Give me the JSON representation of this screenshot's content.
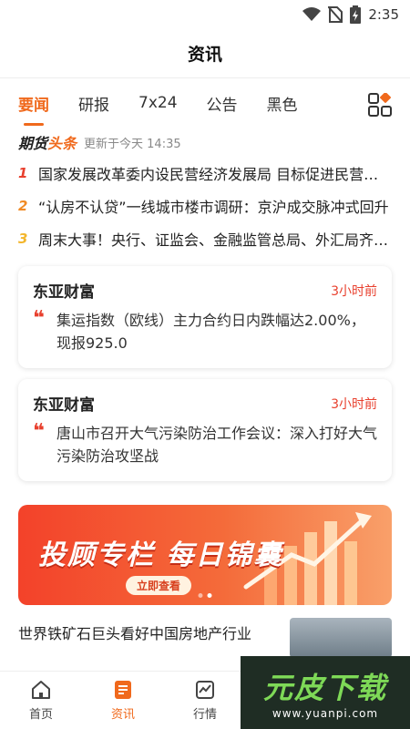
{
  "status_bar": {
    "time": "2:35"
  },
  "header": {
    "title": "资讯"
  },
  "tabs": [
    {
      "label": "要闻",
      "active": true
    },
    {
      "label": "研报"
    },
    {
      "label": "7x24"
    },
    {
      "label": "公告"
    },
    {
      "label": "黑色"
    }
  ],
  "headlines": {
    "brand_prefix": "期货",
    "brand_suffix": "头条",
    "updated": "更新于今天 14:35",
    "items": [
      {
        "rank": "1",
        "text": "国家发展改革委内设民营经济发展局 目标促进民营经济发展壮大"
      },
      {
        "rank": "2",
        "text": "“认房不认贷”一线城市楼市调研：京沪成交脉冲式回升"
      },
      {
        "rank": "3",
        "text": "周末大事！央行、证监会、金融监管总局、外汇局齐发声"
      }
    ]
  },
  "news_cards": [
    {
      "source": "东亚财富",
      "time": "3小时前",
      "text": "集运指数（欧线）主力合约日内跌幅达2.00%，现报925.0"
    },
    {
      "source": "东亚财富",
      "time": "3小时前",
      "text": "唐山市召开大气污染防治工作会议：深入打好大气污染防治攻坚战"
    }
  ],
  "banner": {
    "title": "投顾专栏 每日锦囊",
    "button": "立即查看",
    "slide_count": 2,
    "active_slide": 1
  },
  "article": {
    "title": "世界铁矿石巨头看好中国房地产行业"
  },
  "bottom_nav": [
    {
      "label": "首页",
      "icon": "home-icon"
    },
    {
      "label": "资讯",
      "icon": "news-icon",
      "active": true
    },
    {
      "label": "行情",
      "icon": "chart-icon"
    }
  ],
  "watermark": {
    "logo": "元皮下载",
    "url": "www.yuanpi.com"
  },
  "colors": {
    "accent": "#f0691c",
    "red": "#e8402e"
  }
}
